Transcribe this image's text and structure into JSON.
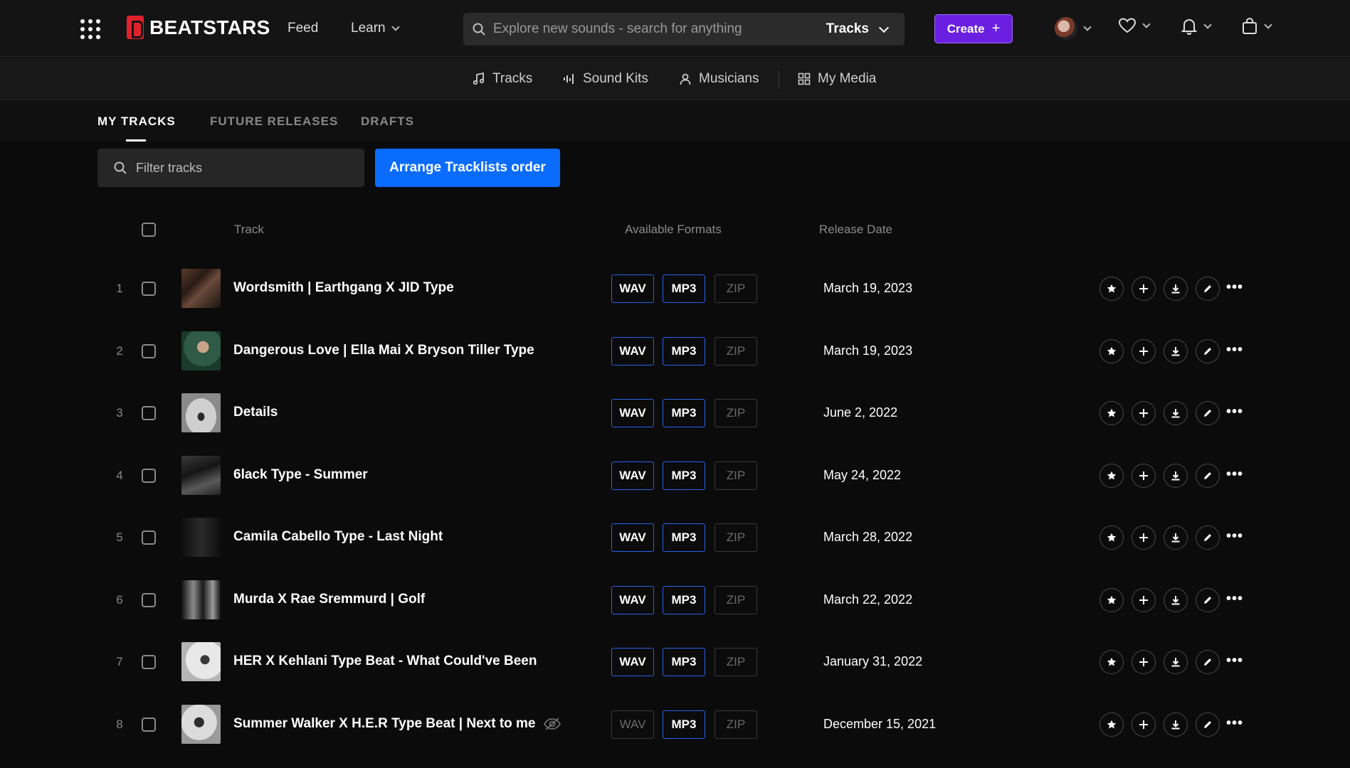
{
  "header": {
    "brand": "BEATSTARS",
    "nav_feed": "Feed",
    "nav_learn": "Learn",
    "search_placeholder": "Explore new sounds - search for anything",
    "search_scope": "Tracks",
    "create_label": "Create",
    "create_plus": "+"
  },
  "subnav": {
    "tracks": "Tracks",
    "sound_kits": "Sound Kits",
    "musicians": "Musicians",
    "my_media": "My Media"
  },
  "tabs": {
    "my_tracks": "MY TRACKS",
    "future_releases": "FUTURE RELEASES",
    "drafts": "DRAFTS"
  },
  "toolbar": {
    "filter_placeholder": "Filter tracks",
    "arrange_label": "Arrange Tracklists order"
  },
  "table": {
    "col_track": "Track",
    "col_formats": "Available Formats",
    "col_release": "Release Date",
    "format_labels": {
      "wav": "WAV",
      "mp3": "MP3",
      "zip": "ZIP"
    },
    "more_glyph": "•••",
    "rows": [
      {
        "num": "1",
        "title": "Wordsmith | Earthgang X JID Type",
        "date": "March 19, 2023",
        "wav": true,
        "mp3": true,
        "zip": false,
        "hidden": false
      },
      {
        "num": "2",
        "title": "Dangerous Love | Ella Mai X Bryson Tiller Type",
        "date": "March 19, 2023",
        "wav": true,
        "mp3": true,
        "zip": false,
        "hidden": false
      },
      {
        "num": "3",
        "title": "Details",
        "date": "June 2, 2022",
        "wav": true,
        "mp3": true,
        "zip": false,
        "hidden": false
      },
      {
        "num": "4",
        "title": "6lack Type - Summer",
        "date": "May 24, 2022",
        "wav": true,
        "mp3": true,
        "zip": false,
        "hidden": false
      },
      {
        "num": "5",
        "title": "Camila Cabello Type - Last Night",
        "date": "March 28, 2022",
        "wav": true,
        "mp3": true,
        "zip": false,
        "hidden": false
      },
      {
        "num": "6",
        "title": "Murda X Rae Sremmurd | Golf",
        "date": "March 22, 2022",
        "wav": true,
        "mp3": true,
        "zip": false,
        "hidden": false
      },
      {
        "num": "7",
        "title": "HER X Kehlani Type Beat - What Could've Been",
        "date": "January 31, 2022",
        "wav": true,
        "mp3": true,
        "zip": false,
        "hidden": false
      },
      {
        "num": "8",
        "title": "Summer Walker X H.E.R Type Beat | Next to me",
        "date": "December 15, 2021",
        "wav": false,
        "mp3": true,
        "zip": false,
        "hidden": true
      }
    ]
  },
  "colors": {
    "background": "#0b0b0b",
    "accent_blue": "#0a6cff",
    "create_purple": "#6b1fe0",
    "brand_red": "#e0212b",
    "format_border": "#2563eb"
  }
}
